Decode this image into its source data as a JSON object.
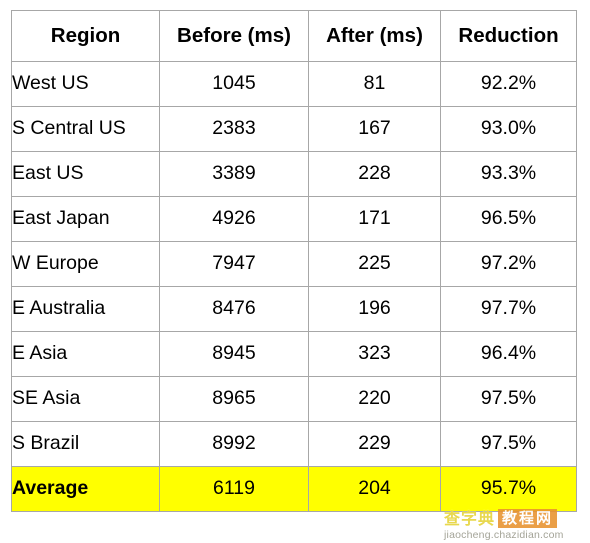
{
  "table": {
    "columns": [
      {
        "key": "region",
        "label": "Region",
        "align": "left"
      },
      {
        "key": "before",
        "label": "Before (ms)",
        "align": "center"
      },
      {
        "key": "after",
        "label": "After (ms)",
        "align": "center"
      },
      {
        "key": "reduction",
        "label": "Reduction",
        "align": "center"
      }
    ],
    "rows": [
      {
        "region": "West US",
        "before": "1045",
        "after": "81",
        "reduction": "92.2%",
        "highlight": false
      },
      {
        "region": "S Central US",
        "before": "2383",
        "after": "167",
        "reduction": "93.0%",
        "highlight": false
      },
      {
        "region": "East US",
        "before": "3389",
        "after": "228",
        "reduction": "93.3%",
        "highlight": false
      },
      {
        "region": "East Japan",
        "before": "4926",
        "after": "171",
        "reduction": "96.5%",
        "highlight": false
      },
      {
        "region": "W Europe",
        "before": "7947",
        "after": "225",
        "reduction": "97.2%",
        "highlight": false
      },
      {
        "region": "E Australia",
        "before": "8476",
        "after": "196",
        "reduction": "97.7%",
        "highlight": false
      },
      {
        "region": "E Asia",
        "before": "8945",
        "after": "323",
        "reduction": "96.4%",
        "highlight": false
      },
      {
        "region": "SE Asia",
        "before": "8965",
        "after": "220",
        "reduction": "97.5%",
        "highlight": false
      },
      {
        "region": "S Brazil",
        "before": "8992",
        "after": "229",
        "reduction": "97.5%",
        "highlight": false
      },
      {
        "region": "Average",
        "before": "6119",
        "after": "204",
        "reduction": "95.7%",
        "highlight": true
      }
    ]
  },
  "watermark": {
    "cn_left": "查字典",
    "cn_right": "教程网",
    "url": "jiaocheng.chazidian.com"
  },
  "colors": {
    "highlight_background": "#ffff00",
    "border": "#a7a7a7",
    "text": "#000000",
    "page_background": "#ffffff",
    "watermark_gold": "#e8d84e",
    "watermark_orange": "#e8922e"
  }
}
